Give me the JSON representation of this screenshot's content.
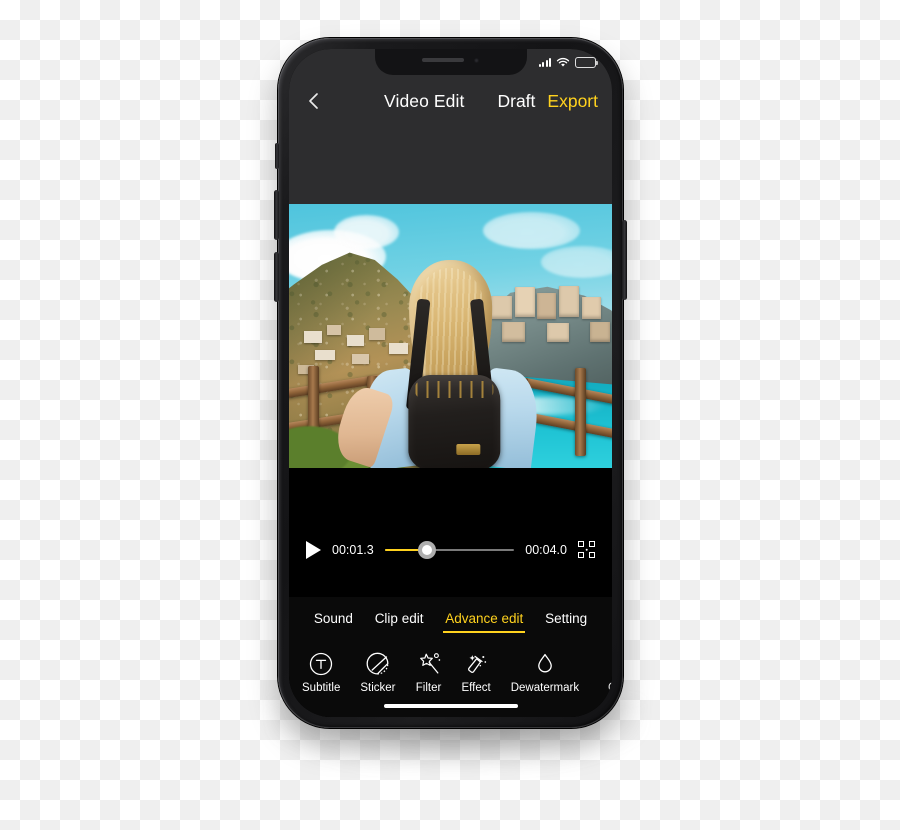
{
  "statusbar": {
    "signal_icon": "cellular-signal-icon",
    "wifi_icon": "wifi-icon",
    "battery_icon": "battery-icon"
  },
  "navbar": {
    "back_icon": "back-chevron-icon",
    "title": "Video Edit",
    "draft_label": "Draft",
    "export_label": "Export",
    "export_color": "#ffd21e"
  },
  "preview": {
    "alt": "Blonde woman with black studded backpack looking at a cliffside coastal village"
  },
  "playback": {
    "play_icon": "play-icon",
    "current_time": "00:01.3",
    "total_time": "00:04.0",
    "progress_percent": 33,
    "fullscreen_icon": "fullscreen-icon",
    "track_fill_color": "#ffd21e"
  },
  "tabs": [
    {
      "label": "Sound",
      "active": false
    },
    {
      "label": "Clip edit",
      "active": false
    },
    {
      "label": "Advance edit",
      "active": true
    },
    {
      "label": "Setting",
      "active": false
    }
  ],
  "tools": [
    {
      "label": "Subtitle",
      "icon": "subtitle-text-icon"
    },
    {
      "label": "Sticker",
      "icon": "sticker-icon"
    },
    {
      "label": "Filter",
      "icon": "magic-wand-filter-icon"
    },
    {
      "label": "Effect",
      "icon": "sparkle-effect-icon"
    },
    {
      "label": "Dewatermark",
      "icon": "water-drop-icon"
    },
    {
      "label": "C",
      "icon": "clipped-tool-icon"
    }
  ],
  "home_indicator": "home-indicator-bar"
}
